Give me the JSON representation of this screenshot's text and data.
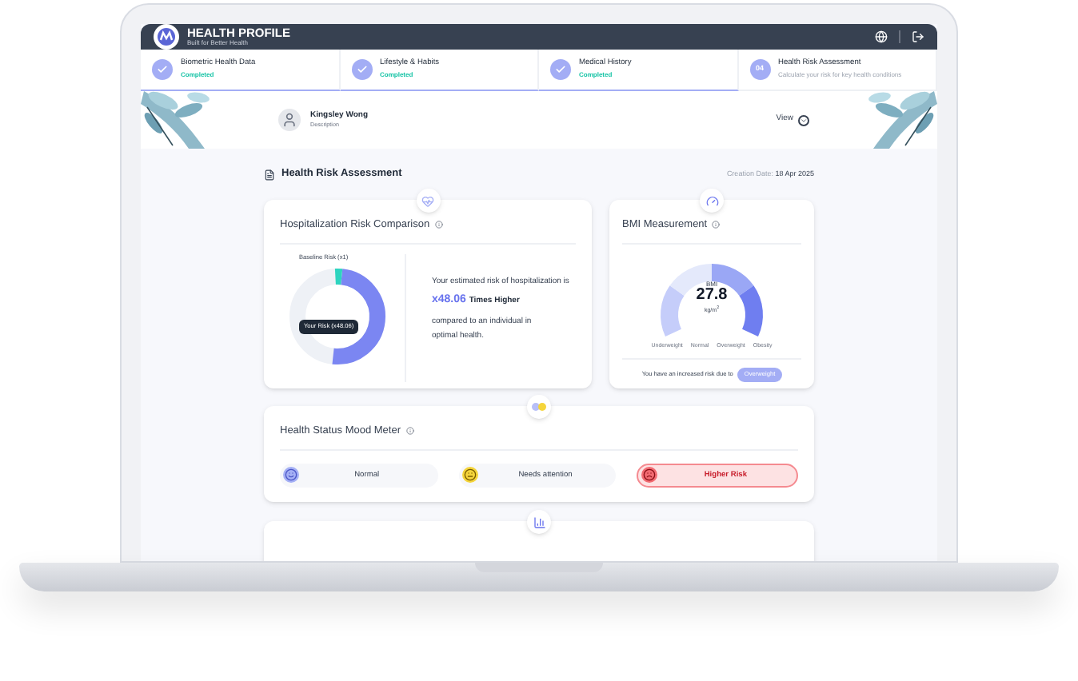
{
  "header": {
    "title": "HEALTH PROFILE",
    "subtitle": "Built for Better Health"
  },
  "steps": [
    {
      "title": "Biometric Health Data",
      "status": "Completed",
      "completed": true
    },
    {
      "title": "Lifestyle & Habits",
      "status": "Completed",
      "completed": true
    },
    {
      "title": "Medical History",
      "status": "Completed",
      "completed": true
    },
    {
      "number": "04",
      "title": "Health Risk Assessment",
      "status": "Calculate your risk for key health conditions",
      "completed": false
    }
  ],
  "profile": {
    "name": "Kingsley Wong",
    "description": "Description",
    "view_label": "View"
  },
  "assessment": {
    "title": "Health Risk Assessment",
    "date_label": "Creation Date:",
    "date": "18 Apr 2025"
  },
  "hospitalization": {
    "title": "Hospitalization Risk Comparison",
    "baseline_label": "Baseline Risk (x1)",
    "your_risk_label": "Your Risk (x48.06)",
    "level": 0.5,
    "text_before": "Your estimated risk of hospitalization is",
    "highlight": "x48.06",
    "highlight_suffix": "Times Higher",
    "text_after": "compared to an individual in optimal health."
  },
  "bmi": {
    "title": "BMI Measurement",
    "label": "BMI",
    "value": "27.8",
    "unit": "kg/m$^{2}$",
    "categories": [
      "Underweight",
      "Normal",
      "Overweight",
      "Obesity"
    ],
    "footer": "You have an increased risk due to",
    "badge": "Overweight"
  },
  "mood": {
    "title": "Health Status Mood Meter",
    "items": [
      {
        "label": "Normal",
        "kind": "happy",
        "selected": false
      },
      {
        "label": "Needs attention",
        "kind": "neutral",
        "selected": false
      },
      {
        "label": "Higher Risk",
        "kind": "sad",
        "selected": true
      }
    ]
  }
}
